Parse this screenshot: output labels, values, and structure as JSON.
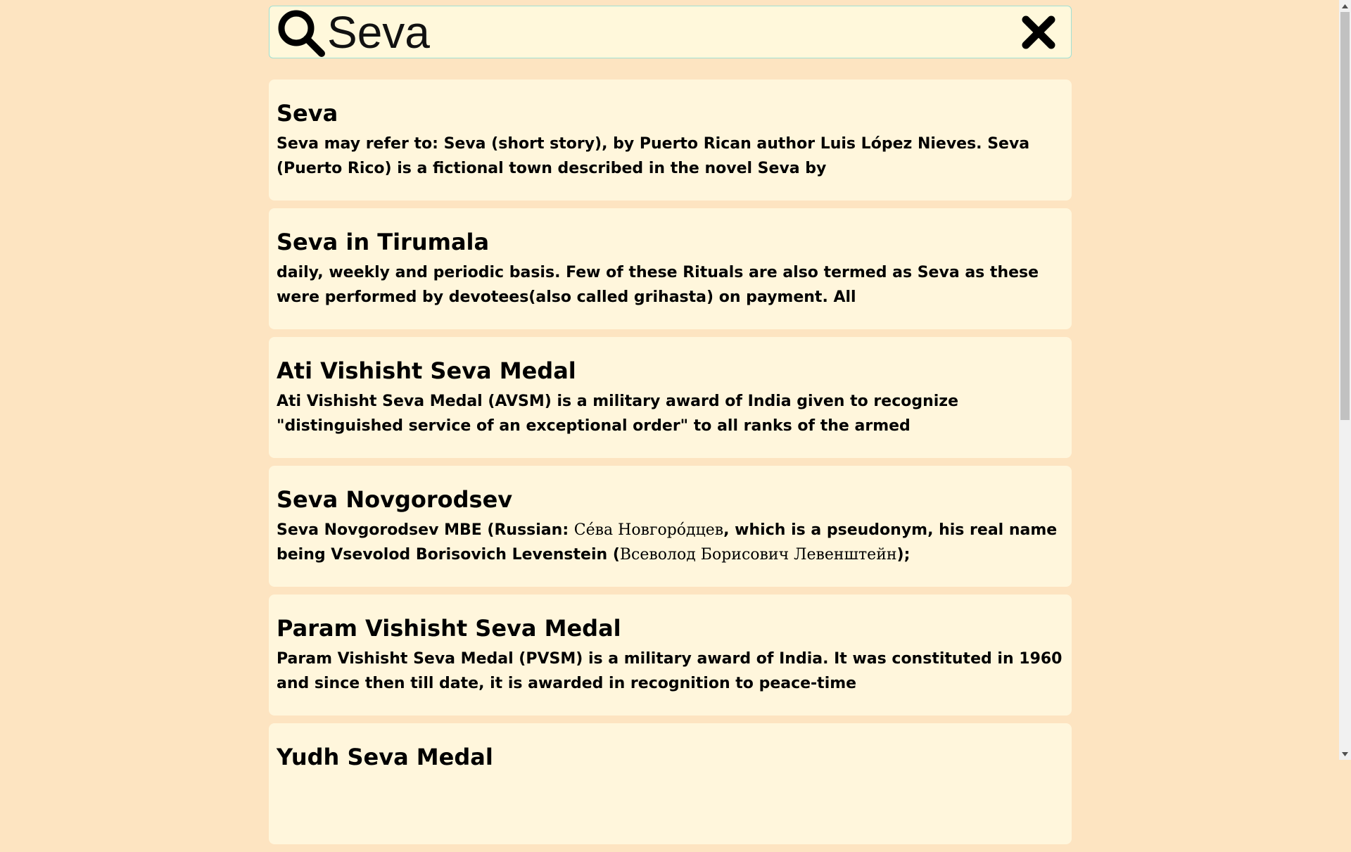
{
  "search": {
    "value": "Seva",
    "icon": "search-icon",
    "clear_icon": "close-icon"
  },
  "results": [
    {
      "title": "Seva",
      "snippet": "Seva may refer to: Seva (short story), by Puerto Rican author Luis López Nieves. Seva (Puerto Rico) is a fictional town described in the novel Seva by"
    },
    {
      "title": "Seva in Tirumala",
      "snippet": "daily, weekly and periodic basis. Few of these Rituals are also termed as Seva as these were performed by devotees(also called grihasta) on payment. All"
    },
    {
      "title": "Ati Vishisht Seva Medal",
      "snippet": "Ati Vishisht Seva Medal (AVSM) is a military award of India given to recognize \"distinguished service of an exceptional order\" to all ranks of the armed"
    },
    {
      "title": "Seva Novgorodsev",
      "snippet_parts": [
        "Seva Novgorodsev MBE (Russian: ",
        "Се́ва Новгоро́дцев",
        ", which is a pseudonym, his real name being Vsevolod Borisovich Levenstein (",
        "Всеволод Борисович Левенштейн",
        ");"
      ]
    },
    {
      "title": "Param Vishisht Seva Medal",
      "snippet": "Param Vishisht Seva Medal (PVSM) is a military award of India. It was constituted in 1960 and since then till date, it is awarded in recognition to peace-time"
    },
    {
      "title": "Yudh Seva Medal",
      "snippet": ""
    }
  ],
  "colors": {
    "page_background": "#fde4c1",
    "card_background": "#fff6dc",
    "search_border": "#9fe0d4"
  }
}
